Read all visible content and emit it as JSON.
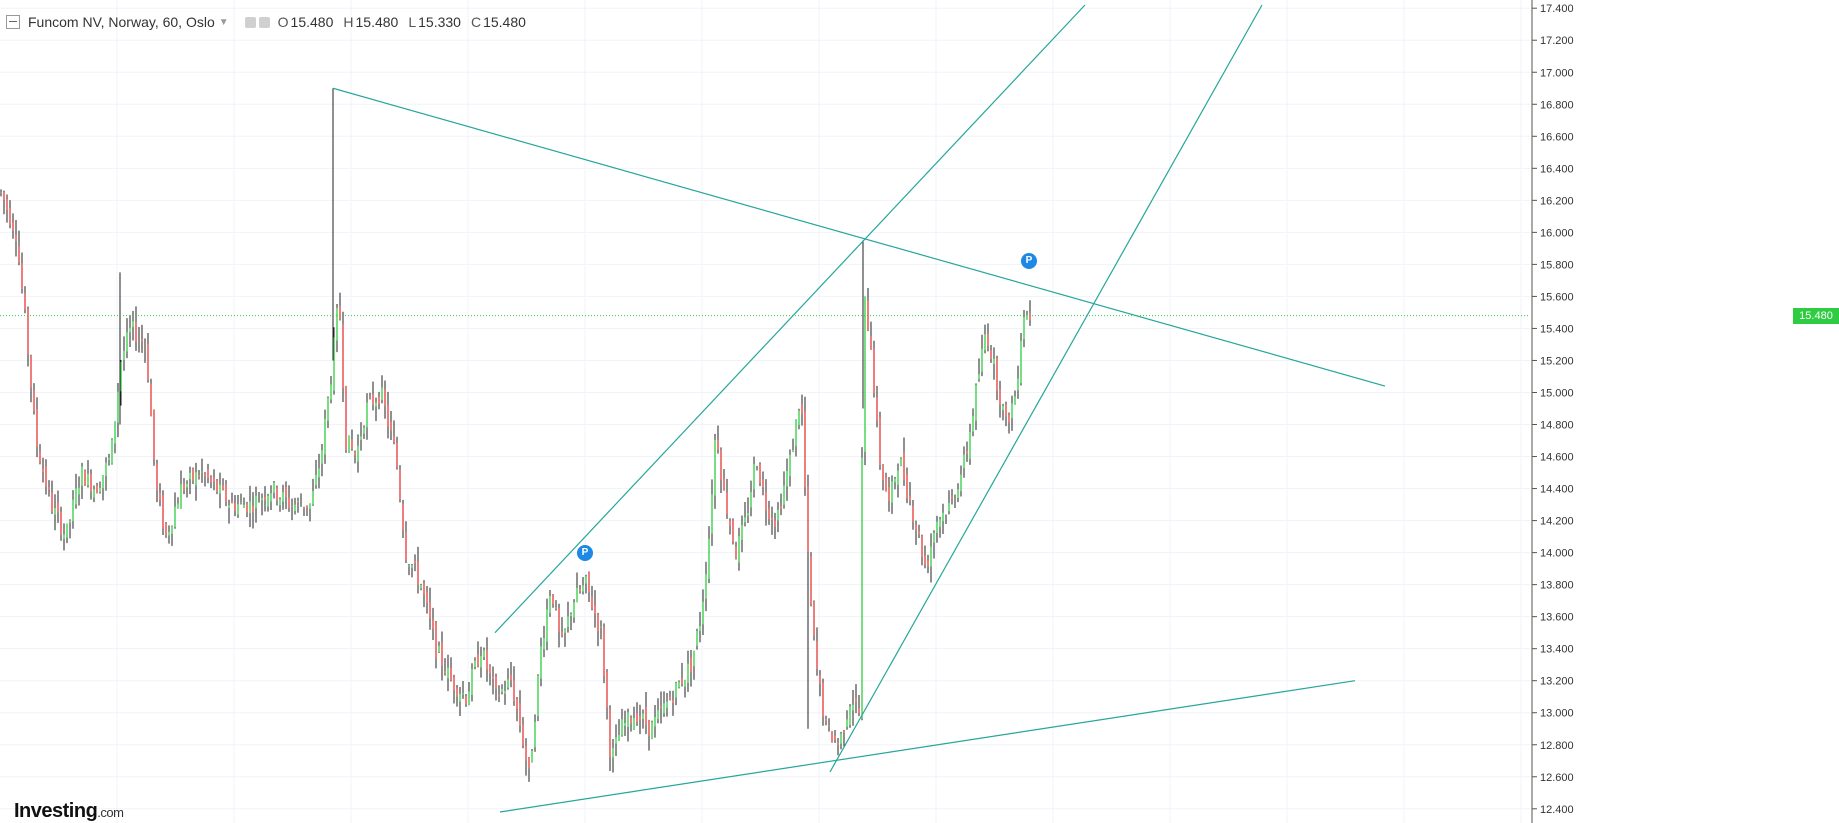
{
  "header": {
    "title": "Funcom NV, Norway, 60, Oslo",
    "open_label": "O",
    "open": "15.480",
    "high_label": "H",
    "high": "15.480",
    "low_label": "L",
    "low": "15.330",
    "close_label": "C",
    "close": "15.480"
  },
  "logo": {
    "brand": "Investing",
    "suffix": ".com"
  },
  "current_price_label": "15.480",
  "pivot_badge_label": "P",
  "colors": {
    "up": "#2ecc40",
    "down": "#e53935",
    "wick": "#222222",
    "trendline": "#26a69a",
    "price_line": "#2ecc40",
    "badge": "#1e88e5"
  },
  "chart_data": {
    "type": "candlestick",
    "y_axis": {
      "ticks": [
        "12.400",
        "12.600",
        "12.800",
        "13.000",
        "13.200",
        "13.400",
        "13.600",
        "13.800",
        "14.000",
        "14.200",
        "14.400",
        "14.600",
        "14.800",
        "15.000",
        "15.200",
        "15.400",
        "15.600",
        "15.800",
        "16.000",
        "16.200",
        "16.400",
        "16.600",
        "16.800",
        "17.000",
        "17.200",
        "17.400"
      ],
      "ylim": [
        12.38,
        17.42
      ],
      "position": "right"
    },
    "current_price": 15.48,
    "x_index_range": [
      0,
      1530
    ],
    "price_path": [
      [
        0,
        16.25
      ],
      [
        15,
        16.0
      ],
      [
        25,
        15.4
      ],
      [
        35,
        14.7
      ],
      [
        50,
        14.3
      ],
      [
        65,
        14.1
      ],
      [
        80,
        14.5
      ],
      [
        95,
        14.4
      ],
      [
        110,
        14.6
      ],
      [
        120,
        15.2
      ],
      [
        130,
        15.4
      ],
      [
        145,
        15.3
      ],
      [
        155,
        14.4
      ],
      [
        165,
        14.1
      ],
      [
        180,
        14.4
      ],
      [
        200,
        14.5
      ],
      [
        215,
        14.4
      ],
      [
        230,
        14.3
      ],
      [
        250,
        14.3
      ],
      [
        270,
        14.4
      ],
      [
        290,
        14.3
      ],
      [
        310,
        14.3
      ],
      [
        320,
        14.6
      ],
      [
        330,
        15.1
      ],
      [
        338,
        15.6
      ],
      [
        345,
        14.7
      ],
      [
        355,
        14.6
      ],
      [
        365,
        14.9
      ],
      [
        380,
        15.0
      ],
      [
        395,
        14.6
      ],
      [
        405,
        14.0
      ],
      [
        420,
        13.8
      ],
      [
        435,
        13.4
      ],
      [
        450,
        13.2
      ],
      [
        465,
        13.1
      ],
      [
        480,
        13.4
      ],
      [
        495,
        13.1
      ],
      [
        510,
        13.2
      ],
      [
        520,
        12.9
      ],
      [
        528,
        12.6
      ],
      [
        540,
        13.4
      ],
      [
        550,
        13.8
      ],
      [
        560,
        13.4
      ],
      [
        572,
        13.7
      ],
      [
        585,
        13.8
      ],
      [
        600,
        13.5
      ],
      [
        610,
        12.7
      ],
      [
        620,
        12.9
      ],
      [
        635,
        13.0
      ],
      [
        650,
        12.9
      ],
      [
        670,
        13.1
      ],
      [
        690,
        13.3
      ],
      [
        700,
        13.6
      ],
      [
        708,
        14.1
      ],
      [
        715,
        14.8
      ],
      [
        722,
        14.4
      ],
      [
        735,
        14.0
      ],
      [
        745,
        14.2
      ],
      [
        755,
        14.6
      ],
      [
        765,
        14.3
      ],
      [
        775,
        14.2
      ],
      [
        790,
        14.6
      ],
      [
        800,
        15.0
      ],
      [
        808,
        13.8
      ],
      [
        815,
        13.3
      ],
      [
        825,
        12.9
      ],
      [
        838,
        12.8
      ],
      [
        850,
        13.1
      ],
      [
        858,
        13.0
      ],
      [
        863,
        15.6
      ],
      [
        870,
        15.3
      ],
      [
        878,
        14.6
      ],
      [
        888,
        14.3
      ],
      [
        898,
        14.6
      ],
      [
        910,
        14.3
      ],
      [
        925,
        13.9
      ],
      [
        935,
        14.2
      ],
      [
        950,
        14.3
      ],
      [
        965,
        14.6
      ],
      [
        975,
        15.0
      ],
      [
        985,
        15.4
      ],
      [
        995,
        15.1
      ],
      [
        1005,
        14.8
      ],
      [
        1015,
        15.0
      ],
      [
        1022,
        15.5
      ],
      [
        1030,
        15.48
      ]
    ]
  },
  "overlays": {
    "trendlines": [
      {
        "name": "descending-resistance",
        "from": [
          333,
          16.9
        ],
        "to": [
          1385,
          15.04
        ]
      },
      {
        "name": "upper-channel",
        "from": [
          495,
          13.5
        ],
        "to": [
          1085,
          17.42
        ]
      },
      {
        "name": "steep-support",
        "from": [
          830,
          12.63
        ],
        "to": [
          1262,
          17.42
        ]
      },
      {
        "name": "lower-support",
        "from": [
          500,
          12.38
        ],
        "to": [
          1355,
          13.2
        ]
      }
    ],
    "pivots": [
      {
        "x": 585,
        "price": 14.0
      },
      {
        "x": 1029,
        "price": 15.82
      }
    ]
  }
}
